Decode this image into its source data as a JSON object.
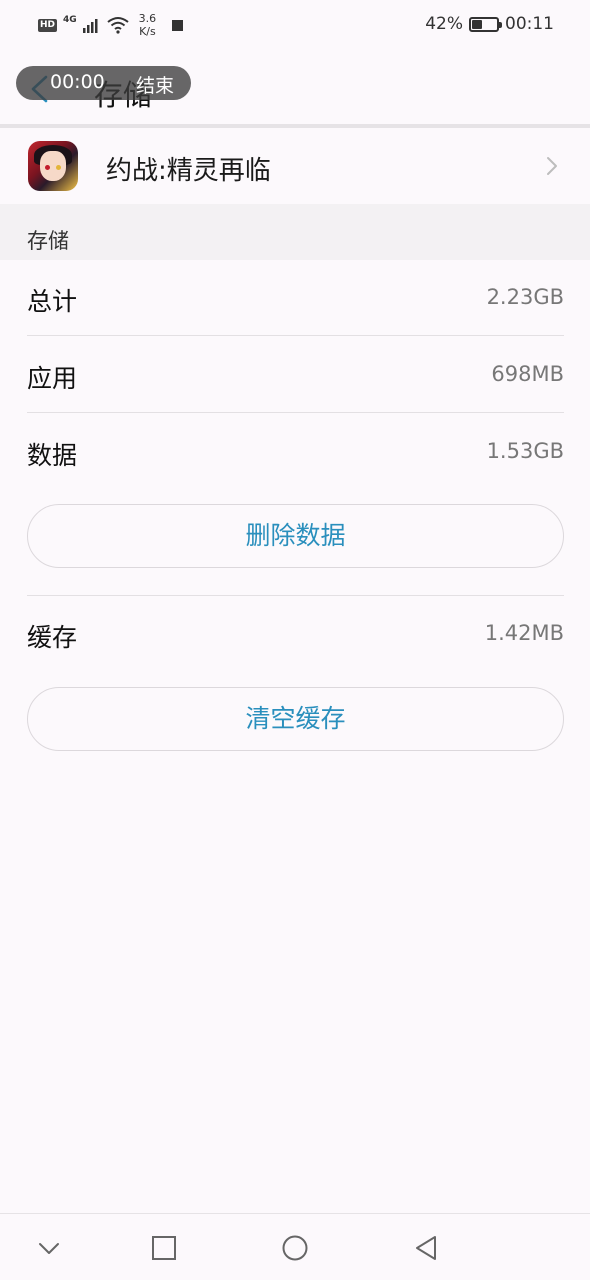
{
  "status_bar": {
    "hd": "HD",
    "network": "4G",
    "speed_value": "3.6",
    "speed_unit": "K/s",
    "battery_percent": "42%",
    "battery_level": 0.42,
    "time": "00:11"
  },
  "recording": {
    "time": "00:00",
    "end_label": "结束"
  },
  "header": {
    "title": "存储"
  },
  "app": {
    "name": "约战:精灵再临"
  },
  "section": {
    "title": "存储"
  },
  "storage": {
    "total_label": "总计",
    "total_value": "2.23GB",
    "app_label": "应用",
    "app_value": "698MB",
    "data_label": "数据",
    "data_value": "1.53GB",
    "delete_data_button": "删除数据",
    "cache_label": "缓存",
    "cache_value": "1.42MB",
    "clear_cache_button": "清空缓存"
  },
  "nav": {
    "icons": [
      "chevron-down-icon",
      "square-icon",
      "circle-icon",
      "triangle-back-icon"
    ]
  },
  "colors": {
    "background": "#fcf9fc",
    "accent": "#2a8fbd",
    "value_text": "#777777"
  }
}
